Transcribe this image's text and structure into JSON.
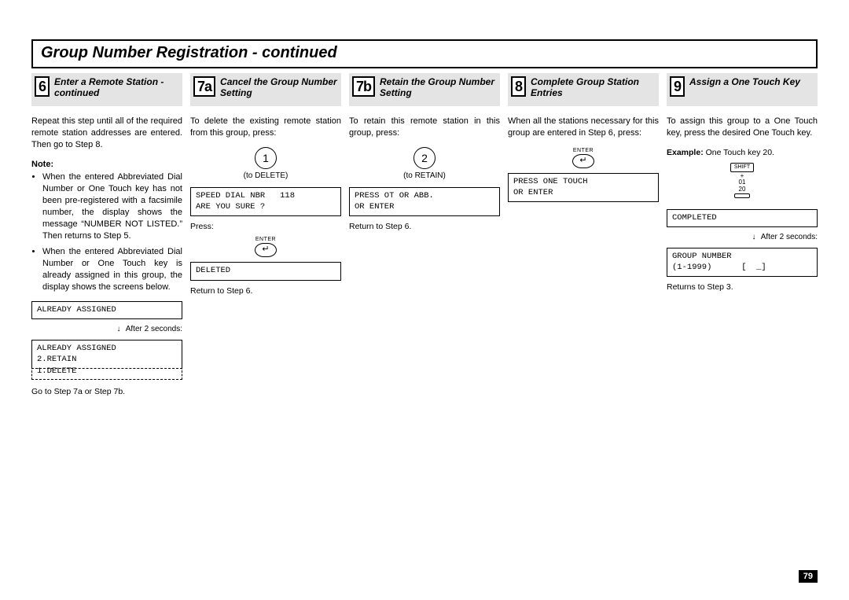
{
  "page_number": "79",
  "title": "Group Number Registration - continued",
  "columns": {
    "c6": {
      "num": "6",
      "title": "Enter a Remote Station - continued",
      "p1": "Repeat this step until all of the required remote station addresses are entered. Then go to Step 8.",
      "note_label": "Note:",
      "note1": "When the entered Abbreviated Dial Number or One Touch key has not been pre-registered with a facsimile number, the display shows the message “NUMBER NOT LISTED.” Then returns to Step 5.",
      "note2": "When the entered Abbreviated Dial Number or One Touch key is already assigned in this group, the display shows the screens below.",
      "lcd1": "ALREADY ASSIGNED",
      "after2": "After 2 seconds:",
      "lcd2": "ALREADY ASSIGNED\n2.RETAIN",
      "lcd2b": "1.DELETE",
      "p2": "Go to Step 7a or Step 7b."
    },
    "c7a": {
      "num": "7a",
      "title": "Cancel the Group Number Setting",
      "p1": "To delete the existing remote station from this group, press:",
      "digit": "1",
      "digit_caption": "(to DELETE)",
      "lcd1": "SPEED DIAL NBR   118\nARE YOU SURE ?",
      "press": "Press:",
      "enter_lbl": "ENTER",
      "enter_sym": "↵",
      "lcd2": "DELETED",
      "p2": "Return to Step 6."
    },
    "c7b": {
      "num": "7b",
      "title": "Retain the Group Number Setting",
      "p1": "To retain this remote station in this group, press:",
      "digit": "2",
      "digit_caption": "(to RETAIN)",
      "lcd1": "PRESS OT OR ABB.\nOR ENTER",
      "p2": "Return to Step 6."
    },
    "c8": {
      "num": "8",
      "title": "Complete Group Station Entries",
      "p1": "When all the stations necessary for this group are entered in Step 6,  press:",
      "enter_lbl": "ENTER",
      "enter_sym": "↵",
      "lcd1": "PRESS ONE TOUCH\nOR ENTER"
    },
    "c9": {
      "num": "9",
      "title": "Assign a One Touch Key",
      "p1": "To assign this group to a One Touch key, press the desired One Touch key.",
      "example_label": "Example:",
      "example_text": "One Touch key 20.",
      "shift": "SHIFT",
      "plus": "+",
      "k01": "01",
      "k20": "20",
      "lcd1": "COMPLETED",
      "after2": "After 2 seconds:",
      "lcd2": "GROUP NUMBER\n(1-1999)      [  _]",
      "p2": "Returns to Step 3."
    }
  }
}
